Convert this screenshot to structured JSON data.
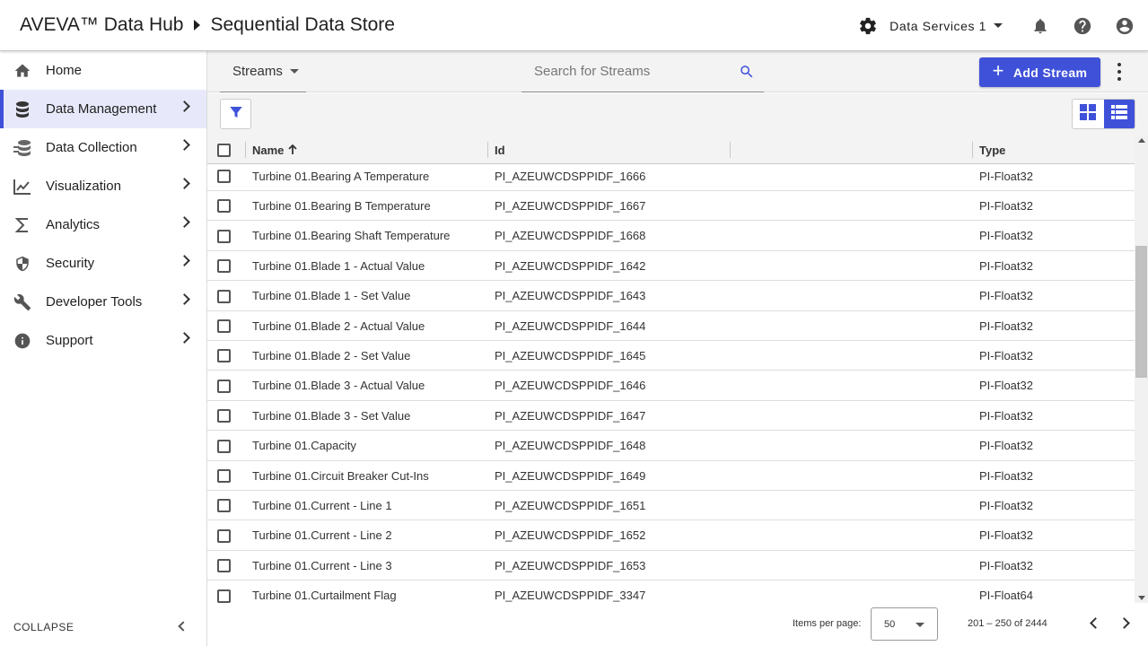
{
  "header": {
    "product": "AVEVA™ Data Hub",
    "page": "Sequential Data Store",
    "tenant": "Data Services 1",
    "icons": [
      "gear-icon",
      "bell-icon",
      "help-icon",
      "account-icon"
    ]
  },
  "sidebar": {
    "items": [
      {
        "label": "Home",
        "icon": "home-icon",
        "expandable": false
      },
      {
        "label": "Data Management",
        "icon": "database-icon",
        "expandable": true,
        "active": true
      },
      {
        "label": "Data Collection",
        "icon": "data-collection-icon",
        "expandable": true
      },
      {
        "label": "Visualization",
        "icon": "line-chart-icon",
        "expandable": true
      },
      {
        "label": "Analytics",
        "icon": "sigma-icon",
        "expandable": true
      },
      {
        "label": "Security",
        "icon": "shield-icon",
        "expandable": true
      },
      {
        "label": "Developer Tools",
        "icon": "wrench-icon",
        "expandable": true
      },
      {
        "label": "Support",
        "icon": "info-icon",
        "expandable": true
      }
    ],
    "collapse_label": "COLLAPSE"
  },
  "toolbar": {
    "selector_label": "Streams",
    "search_placeholder": "Search for Streams",
    "add_label": "Add Stream"
  },
  "table": {
    "columns": {
      "name": "Name",
      "id": "Id",
      "type": "Type"
    },
    "sort": "name-ascending",
    "rows": [
      {
        "name": "Turbine 01.Bearing A Temperature",
        "id": "PI_AZEUWCDSPPIDF_1666",
        "type": "PI-Float32"
      },
      {
        "name": "Turbine 01.Bearing B Temperature",
        "id": "PI_AZEUWCDSPPIDF_1667",
        "type": "PI-Float32"
      },
      {
        "name": "Turbine 01.Bearing Shaft Temperature",
        "id": "PI_AZEUWCDSPPIDF_1668",
        "type": "PI-Float32"
      },
      {
        "name": "Turbine 01.Blade 1 - Actual Value",
        "id": "PI_AZEUWCDSPPIDF_1642",
        "type": "PI-Float32"
      },
      {
        "name": "Turbine 01.Blade 1 - Set Value",
        "id": "PI_AZEUWCDSPPIDF_1643",
        "type": "PI-Float32"
      },
      {
        "name": "Turbine 01.Blade 2 - Actual Value",
        "id": "PI_AZEUWCDSPPIDF_1644",
        "type": "PI-Float32"
      },
      {
        "name": "Turbine 01.Blade 2 - Set Value",
        "id": "PI_AZEUWCDSPPIDF_1645",
        "type": "PI-Float32"
      },
      {
        "name": "Turbine 01.Blade 3 - Actual Value",
        "id": "PI_AZEUWCDSPPIDF_1646",
        "type": "PI-Float32"
      },
      {
        "name": "Turbine 01.Blade 3 - Set Value",
        "id": "PI_AZEUWCDSPPIDF_1647",
        "type": "PI-Float32"
      },
      {
        "name": "Turbine 01.Capacity",
        "id": "PI_AZEUWCDSPPIDF_1648",
        "type": "PI-Float32"
      },
      {
        "name": "Turbine 01.Circuit Breaker Cut-Ins",
        "id": "PI_AZEUWCDSPPIDF_1649",
        "type": "PI-Float32"
      },
      {
        "name": "Turbine 01.Current - Line 1",
        "id": "PI_AZEUWCDSPPIDF_1651",
        "type": "PI-Float32"
      },
      {
        "name": "Turbine 01.Current - Line 2",
        "id": "PI_AZEUWCDSPPIDF_1652",
        "type": "PI-Float32"
      },
      {
        "name": "Turbine 01.Current - Line 3",
        "id": "PI_AZEUWCDSPPIDF_1653",
        "type": "PI-Float32"
      },
      {
        "name": "Turbine 01.Curtailment Flag",
        "id": "PI_AZEUWCDSPPIDF_3347",
        "type": "PI-Float64"
      }
    ]
  },
  "paginator": {
    "items_per_page_label": "Items per page:",
    "items_per_page": "50",
    "range": "201 – 250 of 2444"
  },
  "colors": {
    "accent": "#3f51d9",
    "active_nav_bg": "#e7e9fb"
  }
}
